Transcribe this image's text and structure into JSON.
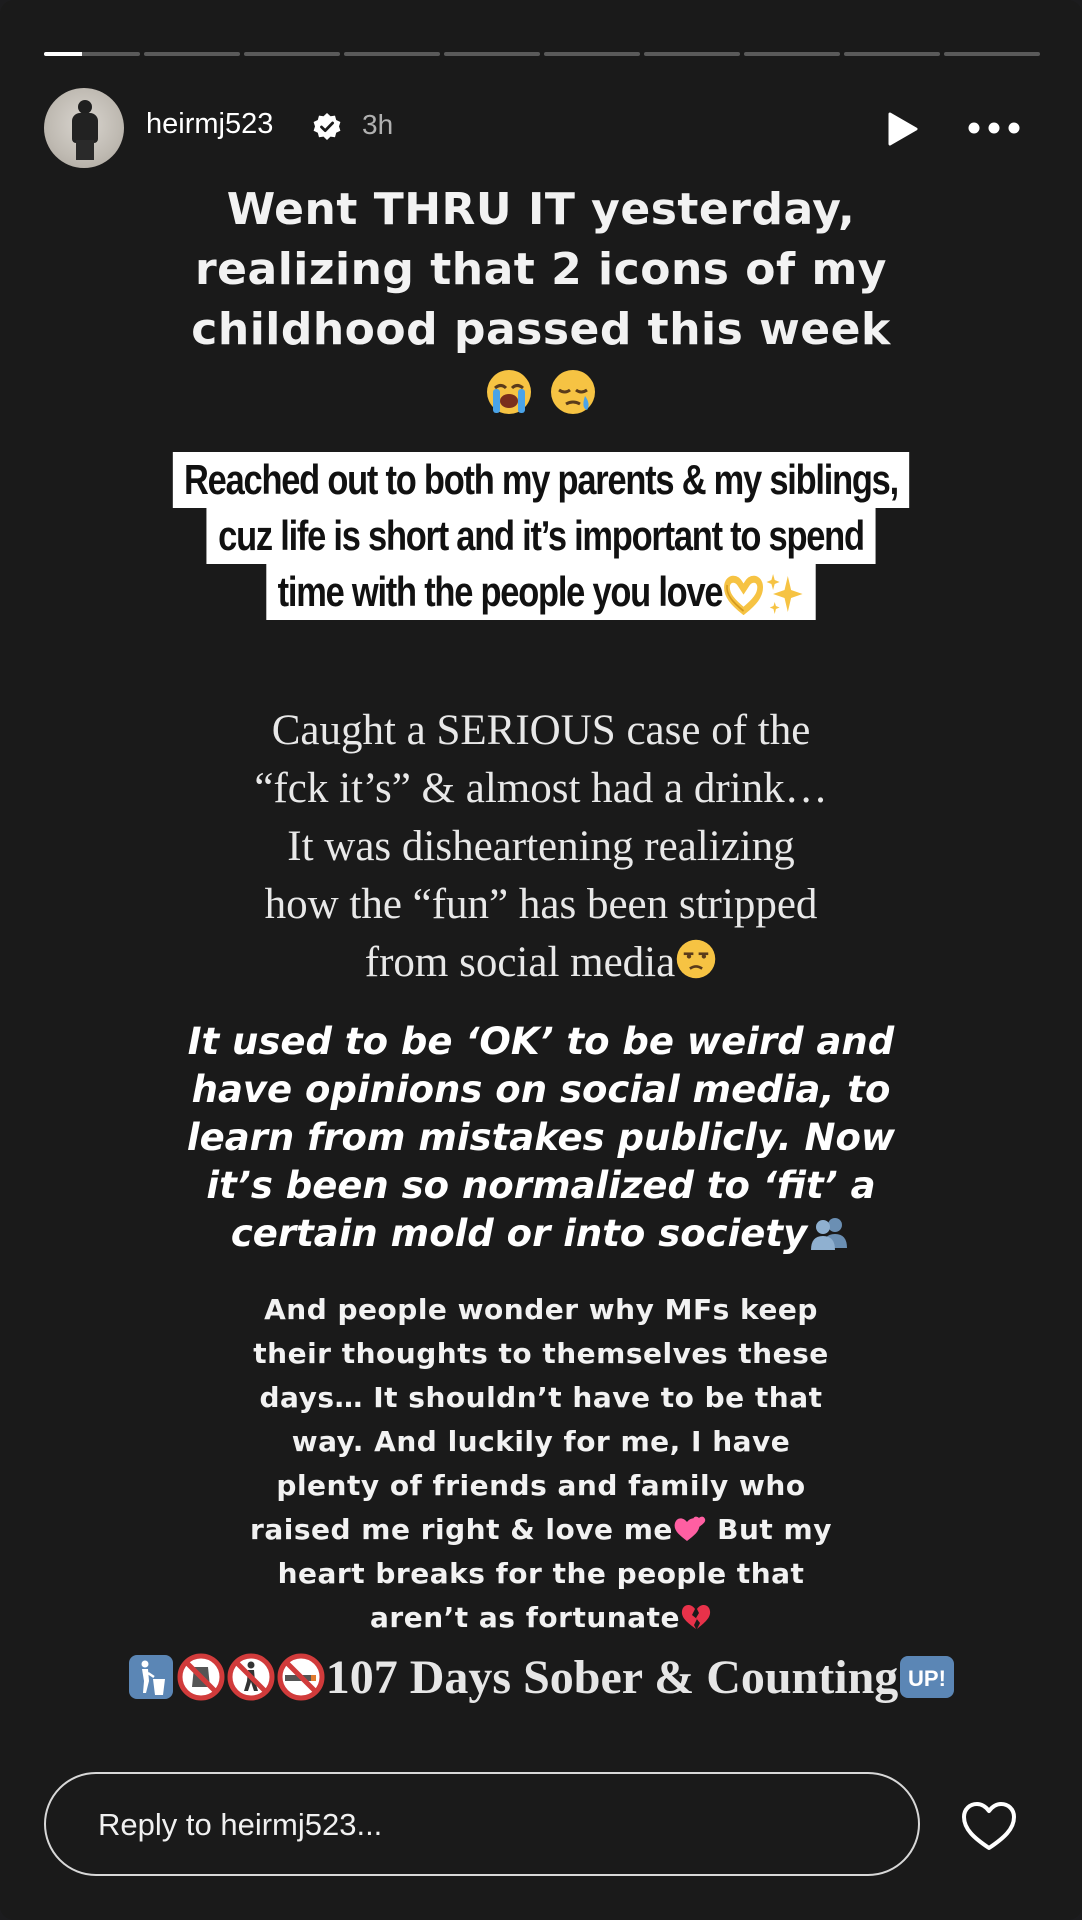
{
  "story": {
    "progress_segments": 10,
    "active_segment": 1,
    "active_progress": 0.4
  },
  "header": {
    "username": "heirmj523",
    "time": "3h",
    "verified": true,
    "icons": [
      "avatar",
      "verified-badge-icon",
      "play-icon",
      "more-icon"
    ]
  },
  "content": {
    "block1_lines": [
      "Went THRU IT yesterday,",
      "realizing that 2 icons of my",
      "childhood passed this week"
    ],
    "block1_emojis": [
      "loudly-crying-face",
      "sleepy-face"
    ],
    "block2_lines": [
      "Reached out to both my parents & my siblings,",
      "cuz life is short and it’s important to spend",
      "time with the people you love"
    ],
    "block2_emojis": [
      "heart-hands",
      "sparkles"
    ],
    "block3_lines": [
      "Caught a SERIOUS case of the",
      "“fck it’s” & almost had a drink…",
      "It was disheartening realizing",
      "how the “fun” has been stripped",
      "from social media"
    ],
    "block3_emoji": "unamused-face",
    "block4_lines": [
      "It used to be ‘OK’ to be weird and",
      "have opinions on social media, to",
      "learn from mistakes publicly. Now",
      "it’s been so normalized to ‘fit’ a",
      "certain mold or into society"
    ],
    "block4_emoji": "busts-in-silhouette",
    "block5_lines": [
      "And people wonder why MFs keep",
      "their thoughts to themselves these",
      "days… It shouldn’t have to be that",
      "way. And luckily for me, I have",
      "plenty of friends and family who",
      "raised me right & love me",
      "heart breaks for the people that",
      "aren’t as fortunate"
    ],
    "block5_line6_tail": " But my",
    "block5_emojis": [
      "revolving-hearts",
      "broken-heart"
    ],
    "block6_text": "107 Days Sober & Counting",
    "block6_emojis_before": [
      "litter-in-bin-sign",
      "no-entry-sign",
      "no-pedestrians",
      "no-smoking"
    ],
    "block6_emoji_after_label": "UP!"
  },
  "footer": {
    "reply_placeholder": "Reply to heirmj523...",
    "like_icon": "heart-outline-icon"
  },
  "colors": {
    "background": "#1a1a1a",
    "highlight": "#ffffff",
    "emoji_blue": "#5b86b5",
    "emoji_red": "#d13b3b",
    "heart_pink": "#ff5fa2",
    "broken_heart_red": "#e8324a",
    "emoji_yellow": "#f6c343"
  }
}
